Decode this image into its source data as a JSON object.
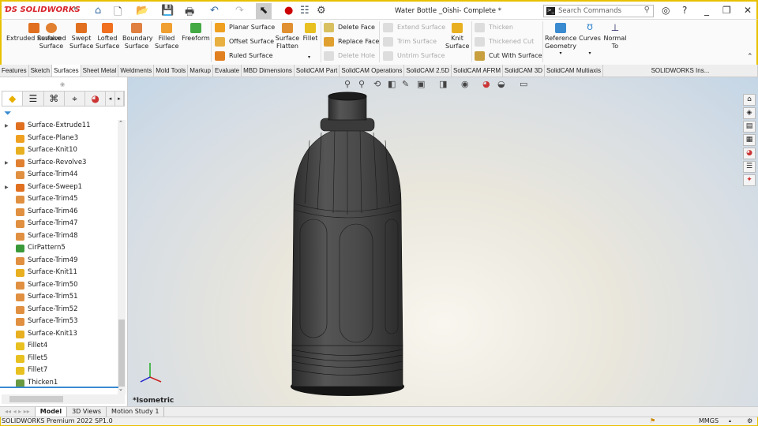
{
  "app": {
    "logo": "SOLIDWORKS",
    "title": "Water Bottle _Oishi- Complete *"
  },
  "search": {
    "placeholder": "Search Commands"
  },
  "ribbon": {
    "big": [
      "Extruded Surface",
      "Revolved Surface",
      "Swept Surface",
      "Lofted Surface",
      "Boundary Surface",
      "Filled Surface",
      "Freeform"
    ],
    "col1": [
      "Planar Surface",
      "Offset Surface",
      "Ruled Surface"
    ],
    "flatten": "Surface Flatten",
    "fillet": "Fillet",
    "col2": [
      "Delete Face",
      "Replace Face",
      "Delete Hole"
    ],
    "col3": [
      "Extend Surface",
      "Trim Surface",
      "Untrim Surface"
    ],
    "knit": "Knit Surface",
    "col4": [
      "Thicken",
      "Thickened Cut",
      "Cut With Surface"
    ],
    "ref": "Reference Geometry",
    "curves": "Curves",
    "normal": "Normal To"
  },
  "tabs": [
    "Features",
    "Sketch",
    "Surfaces",
    "Sheet Metal",
    "Weldments",
    "Mold Tools",
    "Markup",
    "Evaluate",
    "MBD Dimensions",
    "SolidCAM Part",
    "SolidCAM Operations",
    "SolidCAM 2.5D",
    "SolidCAM AFRM",
    "SolidCAM 3D",
    "SolidCAM Multiaxis",
    "SOLIDWORKS Ins..."
  ],
  "tree": [
    {
      "label": "Surface-Extrude11",
      "type": "extrude",
      "exp": true
    },
    {
      "label": "Surface-Plane3",
      "type": "plane"
    },
    {
      "label": "Surface-Knit10",
      "type": "knit"
    },
    {
      "label": "Surface-Revolve3",
      "type": "revolve",
      "exp": true
    },
    {
      "label": "Surface-Trim44",
      "type": "trim"
    },
    {
      "label": "Surface-Sweep1",
      "type": "sweep",
      "exp": true
    },
    {
      "label": "Surface-Trim45",
      "type": "trim"
    },
    {
      "label": "Surface-Trim46",
      "type": "trim"
    },
    {
      "label": "Surface-Trim47",
      "type": "trim"
    },
    {
      "label": "Surface-Trim48",
      "type": "trim"
    },
    {
      "label": "CirPattern5",
      "type": "pattern"
    },
    {
      "label": "Surface-Trim49",
      "type": "trim"
    },
    {
      "label": "Surface-Knit11",
      "type": "knit"
    },
    {
      "label": "Surface-Trim50",
      "type": "trim"
    },
    {
      "label": "Surface-Trim51",
      "type": "trim"
    },
    {
      "label": "Surface-Trim52",
      "type": "trim"
    },
    {
      "label": "Surface-Trim53",
      "type": "trim"
    },
    {
      "label": "Surface-Knit13",
      "type": "knit"
    },
    {
      "label": "Fillet4",
      "type": "fillet"
    },
    {
      "label": "Fillet5",
      "type": "fillet"
    },
    {
      "label": "Fillet7",
      "type": "fillet"
    },
    {
      "label": "Thicken1",
      "type": "thicken"
    }
  ],
  "view": {
    "orientation": "*Isometric"
  },
  "bottom_tabs": [
    "Model",
    "3D Views",
    "Motion Study 1"
  ],
  "status": {
    "product": "SOLIDWORKS Premium 2022 SP1.0",
    "units": "MMGS"
  },
  "colors": {
    "accent": "#e8c000",
    "icon": "#e07020"
  }
}
